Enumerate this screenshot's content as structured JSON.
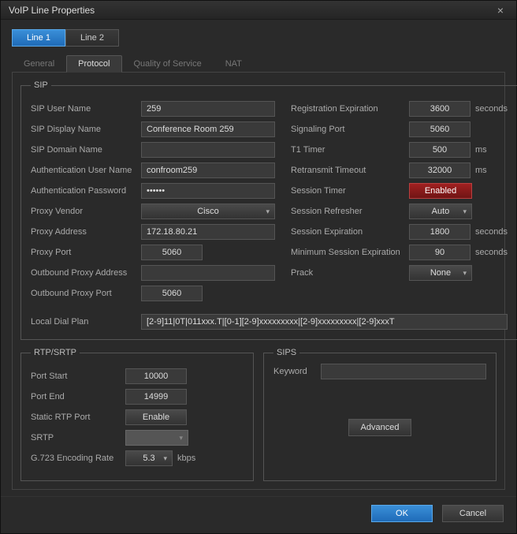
{
  "window": {
    "title": "VoIP Line Properties"
  },
  "line_tabs": {
    "line1": "Line 1",
    "line2": "Line 2"
  },
  "sub_tabs": {
    "general": "General",
    "protocol": "Protocol",
    "qos": "Quality of Service",
    "nat": "NAT"
  },
  "sip": {
    "legend": "SIP",
    "labels": {
      "user_name": "SIP User Name",
      "display_name": "SIP Display Name",
      "domain_name": "SIP Domain Name",
      "auth_user": "Authentication User Name",
      "auth_pass": "Authentication Password",
      "proxy_vendor": "Proxy Vendor",
      "proxy_addr": "Proxy Address",
      "proxy_port": "Proxy Port",
      "outbound_addr": "Outbound Proxy Address",
      "outbound_port": "Outbound Proxy Port",
      "reg_exp": "Registration Expiration",
      "sig_port": "Signaling Port",
      "t1": "T1 Timer",
      "retransmit": "Retransmit Timeout",
      "session_timer": "Session Timer",
      "session_refresher": "Session Refresher",
      "session_exp": "Session Expiration",
      "min_session": "Minimum Session Expiration",
      "prack": "Prack",
      "dial_plan": "Local Dial Plan"
    },
    "values": {
      "user_name": "259",
      "display_name": "Conference Room 259",
      "domain_name": "",
      "auth_user": "confroom259",
      "auth_pass": "••••••",
      "proxy_vendor": "Cisco",
      "proxy_addr": "172.18.80.21",
      "proxy_port": "5060",
      "outbound_addr": "",
      "outbound_port": "5060",
      "reg_exp": "3600",
      "sig_port": "5060",
      "t1": "500",
      "retransmit": "32000",
      "session_timer": "Enabled",
      "session_refresher": "Auto",
      "session_exp": "1800",
      "min_session": "90",
      "prack": "None",
      "dial_plan": "[2-9]11|0T|011xxx.T|[0-1][2-9]xxxxxxxxx|[2-9]xxxxxxxxx|[2-9]xxxT"
    },
    "units": {
      "seconds": "seconds",
      "ms": "ms"
    }
  },
  "rtp": {
    "legend": "RTP/SRTP",
    "labels": {
      "port_start": "Port Start",
      "port_end": "Port End",
      "static_rtp": "Static RTP Port",
      "srtp": "SRTP",
      "g723": "G.723 Encoding Rate"
    },
    "values": {
      "port_start": "10000",
      "port_end": "14999",
      "static_rtp": "Enable",
      "g723": "5.3"
    },
    "units": {
      "kbps": "kbps"
    }
  },
  "sips": {
    "legend": "SIPS",
    "labels": {
      "keyword": "Keyword"
    },
    "values": {
      "keyword": ""
    },
    "advanced": "Advanced"
  },
  "footer": {
    "ok": "OK",
    "cancel": "Cancel"
  }
}
